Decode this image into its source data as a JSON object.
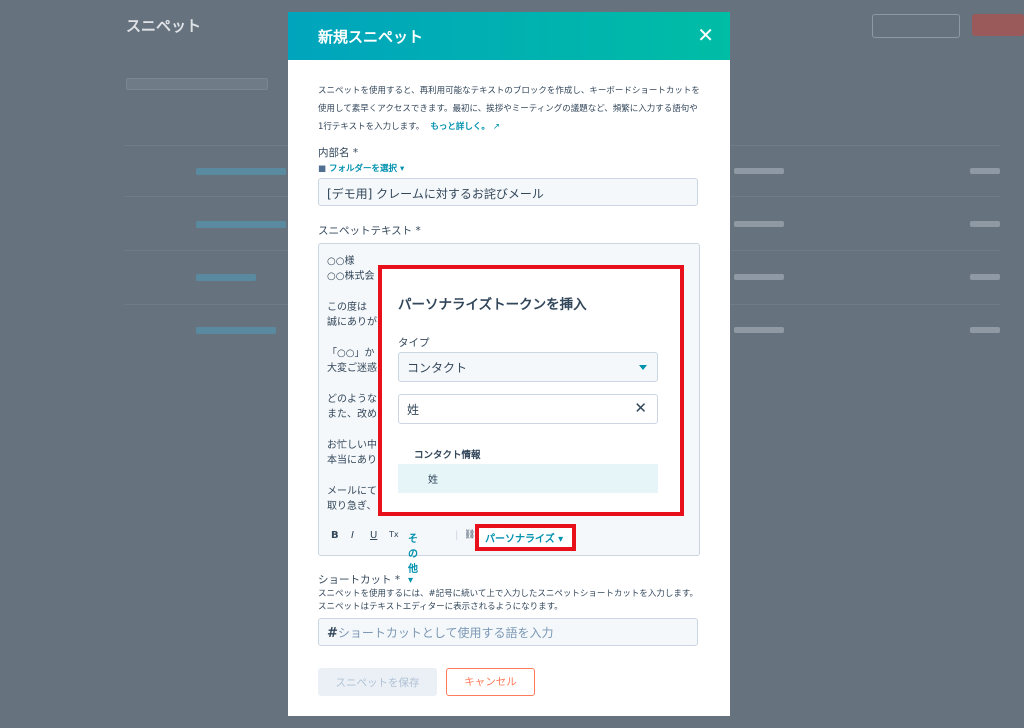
{
  "background": {
    "title": "スニペット"
  },
  "modal": {
    "title": "新規スニペット",
    "description": "スニペットを使用すると、再利用可能なテキストのブロックを作成し、キーボードショートカットを使用して素早くアクセスできます。最初に、挨拶やミーティングの議題など、頻繁に入力する語句や1行テキストを入力します。",
    "learn_more": "もっと詳しく。",
    "internal_name_label": "内部名 *",
    "folder_select": "フォルダーを選択 ▾",
    "internal_name_value": "[デモ用] クレームに対するお詫びメール",
    "snippet_text_label": "スニペットテキスト *",
    "editor_lines": [
      "○○様",
      "○○株式会",
      "この度は",
      "誠にありが",
      "「○○」か",
      "大変ご迷惑",
      "どのような",
      "また、改め",
      "お忙しい中",
      "本当にあり",
      "メールにて",
      "取り急ぎ、"
    ],
    "toolbar": {
      "bold": "B",
      "italic": "I",
      "underline": "U",
      "clear": "Tx",
      "more": "その他 ▾",
      "link": "⛓",
      "personalize": "パーソナライズ ▾"
    },
    "shortcut_label": "ショートカット *",
    "shortcut_hint": "スニペットを使用するには、#記号に続いて上で入力したスニペットショートカットを入力します。スニペットはテキストエディターに表示されるようになります。",
    "shortcut_prefix": "#",
    "shortcut_placeholder": "ショートカットとして使用する語を入力",
    "save_label": "スニペットを保存",
    "cancel_label": "キャンセル"
  },
  "popup": {
    "title": "パーソナライズトークンを挿入",
    "type_label": "タイプ",
    "type_value": "コンタクト",
    "search_value": "姓",
    "group_label": "コンタクト情報",
    "option": "姓"
  },
  "colors": {
    "accent": "#0091ae",
    "highlight": "#e8101a",
    "cancel": "#ff7a59"
  }
}
